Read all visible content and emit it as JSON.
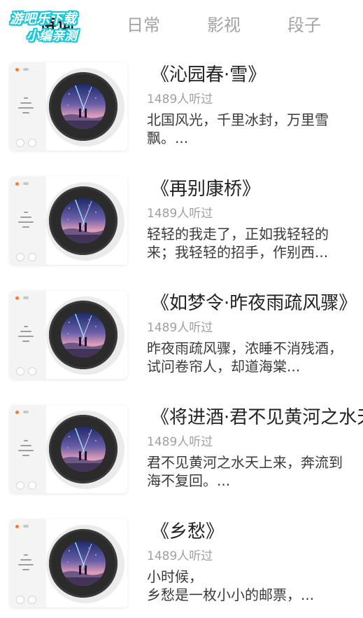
{
  "watermark": {
    "line1": "游吧乐下载",
    "line2": "小编亲测"
  },
  "tabs": [
    {
      "label": "诗词",
      "active": true
    },
    {
      "label": "日常",
      "active": false
    },
    {
      "label": "影视",
      "active": false
    },
    {
      "label": "段子",
      "active": false
    }
  ],
  "colors": {
    "accent_led": "#ff7a2b",
    "title_text": "#222222",
    "meta_text": "#a0a0a0",
    "inactive_tab": "#a3a3a3",
    "watermark": "#18c7d6"
  },
  "items": [
    {
      "title": "《沁园春·雪》",
      "listens": "1489人听过",
      "excerpt": "北国风光，千里冰封，万里雪飘。..."
    },
    {
      "title": "《再别康桥》",
      "listens": "1489人听过",
      "excerpt": "轻轻的我走了，正如我轻轻的来；我轻轻的招手，作别西..."
    },
    {
      "title": "《如梦令·昨夜雨疏风骤》",
      "listens": "1489人听过",
      "excerpt": "昨夜雨疏风骤，浓睡不消残酒，试问卷帘人，却道海棠..."
    },
    {
      "title": "《将进酒·君不见黄河之水天",
      "listens": "1489人听过",
      "excerpt": "君不见黄河之水天上来，奔流到海不复回。..."
    },
    {
      "title": "《乡愁》",
      "listens": "1489人听过",
      "excerpt": "小时候，\n乡愁是一枚小小的邮票，..."
    }
  ]
}
